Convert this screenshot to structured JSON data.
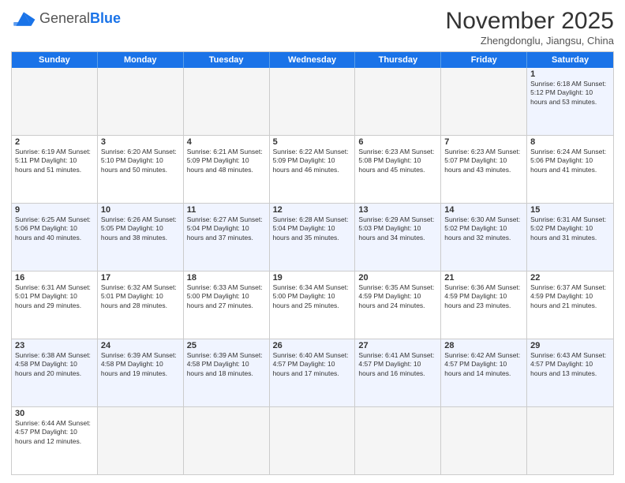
{
  "logo": {
    "text_general": "General",
    "text_blue": "Blue"
  },
  "header": {
    "month": "November 2025",
    "location": "Zhengdonglu, Jiangsu, China"
  },
  "weekdays": [
    "Sunday",
    "Monday",
    "Tuesday",
    "Wednesday",
    "Thursday",
    "Friday",
    "Saturday"
  ],
  "weeks": [
    [
      {
        "day": "",
        "info": ""
      },
      {
        "day": "",
        "info": ""
      },
      {
        "day": "",
        "info": ""
      },
      {
        "day": "",
        "info": ""
      },
      {
        "day": "",
        "info": ""
      },
      {
        "day": "",
        "info": ""
      },
      {
        "day": "1",
        "info": "Sunrise: 6:18 AM\nSunset: 5:12 PM\nDaylight: 10 hours\nand 53 minutes."
      }
    ],
    [
      {
        "day": "2",
        "info": "Sunrise: 6:19 AM\nSunset: 5:11 PM\nDaylight: 10 hours\nand 51 minutes."
      },
      {
        "day": "3",
        "info": "Sunrise: 6:20 AM\nSunset: 5:10 PM\nDaylight: 10 hours\nand 50 minutes."
      },
      {
        "day": "4",
        "info": "Sunrise: 6:21 AM\nSunset: 5:09 PM\nDaylight: 10 hours\nand 48 minutes."
      },
      {
        "day": "5",
        "info": "Sunrise: 6:22 AM\nSunset: 5:09 PM\nDaylight: 10 hours\nand 46 minutes."
      },
      {
        "day": "6",
        "info": "Sunrise: 6:23 AM\nSunset: 5:08 PM\nDaylight: 10 hours\nand 45 minutes."
      },
      {
        "day": "7",
        "info": "Sunrise: 6:23 AM\nSunset: 5:07 PM\nDaylight: 10 hours\nand 43 minutes."
      },
      {
        "day": "8",
        "info": "Sunrise: 6:24 AM\nSunset: 5:06 PM\nDaylight: 10 hours\nand 41 minutes."
      }
    ],
    [
      {
        "day": "9",
        "info": "Sunrise: 6:25 AM\nSunset: 5:06 PM\nDaylight: 10 hours\nand 40 minutes."
      },
      {
        "day": "10",
        "info": "Sunrise: 6:26 AM\nSunset: 5:05 PM\nDaylight: 10 hours\nand 38 minutes."
      },
      {
        "day": "11",
        "info": "Sunrise: 6:27 AM\nSunset: 5:04 PM\nDaylight: 10 hours\nand 37 minutes."
      },
      {
        "day": "12",
        "info": "Sunrise: 6:28 AM\nSunset: 5:04 PM\nDaylight: 10 hours\nand 35 minutes."
      },
      {
        "day": "13",
        "info": "Sunrise: 6:29 AM\nSunset: 5:03 PM\nDaylight: 10 hours\nand 34 minutes."
      },
      {
        "day": "14",
        "info": "Sunrise: 6:30 AM\nSunset: 5:02 PM\nDaylight: 10 hours\nand 32 minutes."
      },
      {
        "day": "15",
        "info": "Sunrise: 6:31 AM\nSunset: 5:02 PM\nDaylight: 10 hours\nand 31 minutes."
      }
    ],
    [
      {
        "day": "16",
        "info": "Sunrise: 6:31 AM\nSunset: 5:01 PM\nDaylight: 10 hours\nand 29 minutes."
      },
      {
        "day": "17",
        "info": "Sunrise: 6:32 AM\nSunset: 5:01 PM\nDaylight: 10 hours\nand 28 minutes."
      },
      {
        "day": "18",
        "info": "Sunrise: 6:33 AM\nSunset: 5:00 PM\nDaylight: 10 hours\nand 27 minutes."
      },
      {
        "day": "19",
        "info": "Sunrise: 6:34 AM\nSunset: 5:00 PM\nDaylight: 10 hours\nand 25 minutes."
      },
      {
        "day": "20",
        "info": "Sunrise: 6:35 AM\nSunset: 4:59 PM\nDaylight: 10 hours\nand 24 minutes."
      },
      {
        "day": "21",
        "info": "Sunrise: 6:36 AM\nSunset: 4:59 PM\nDaylight: 10 hours\nand 23 minutes."
      },
      {
        "day": "22",
        "info": "Sunrise: 6:37 AM\nSunset: 4:59 PM\nDaylight: 10 hours\nand 21 minutes."
      }
    ],
    [
      {
        "day": "23",
        "info": "Sunrise: 6:38 AM\nSunset: 4:58 PM\nDaylight: 10 hours\nand 20 minutes."
      },
      {
        "day": "24",
        "info": "Sunrise: 6:39 AM\nSunset: 4:58 PM\nDaylight: 10 hours\nand 19 minutes."
      },
      {
        "day": "25",
        "info": "Sunrise: 6:39 AM\nSunset: 4:58 PM\nDaylight: 10 hours\nand 18 minutes."
      },
      {
        "day": "26",
        "info": "Sunrise: 6:40 AM\nSunset: 4:57 PM\nDaylight: 10 hours\nand 17 minutes."
      },
      {
        "day": "27",
        "info": "Sunrise: 6:41 AM\nSunset: 4:57 PM\nDaylight: 10 hours\nand 16 minutes."
      },
      {
        "day": "28",
        "info": "Sunrise: 6:42 AM\nSunset: 4:57 PM\nDaylight: 10 hours\nand 14 minutes."
      },
      {
        "day": "29",
        "info": "Sunrise: 6:43 AM\nSunset: 4:57 PM\nDaylight: 10 hours\nand 13 minutes."
      }
    ],
    [
      {
        "day": "30",
        "info": "Sunrise: 6:44 AM\nSunset: 4:57 PM\nDaylight: 10 hours\nand 12 minutes."
      },
      {
        "day": "",
        "info": ""
      },
      {
        "day": "",
        "info": ""
      },
      {
        "day": "",
        "info": ""
      },
      {
        "day": "",
        "info": ""
      },
      {
        "day": "",
        "info": ""
      },
      {
        "day": "",
        "info": ""
      }
    ]
  ],
  "row_styles": [
    "row-odd",
    "row-even",
    "row-odd",
    "row-even",
    "row-odd",
    "row-even"
  ]
}
